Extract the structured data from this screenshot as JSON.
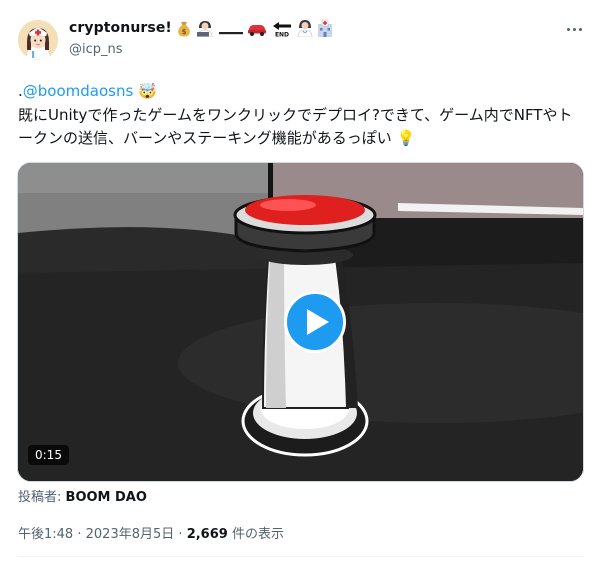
{
  "author": {
    "display_name": "cryptonurse!",
    "handle": "@icp_ns",
    "name_emoji": [
      "money-bag-emoji",
      "person-at-laptop-emoji",
      "car-emoji",
      "end-arrow-emoji",
      "health-worker-emoji",
      "hospital-emoji"
    ]
  },
  "tweet": {
    "prefix": ".",
    "mention": "@boomdaosns",
    "mention_emoji": "🤯",
    "line2": "既にUnityで作ったゲームをワンクリックでデプロイ?できて、ゲーム内でNFTやト",
    "line3": "ークンの送信、バーンやステーキング機能があるっぽい",
    "line3_emoji": "💡"
  },
  "media": {
    "duration": "0:15",
    "poster_label": "投稿者:",
    "poster_name": "BOOM DAO"
  },
  "meta": {
    "time": "午後1:48",
    "separator1": "·",
    "date": "2023年8月5日",
    "separator2": "·",
    "views_count": "2,669",
    "views_label": "件の表示"
  }
}
